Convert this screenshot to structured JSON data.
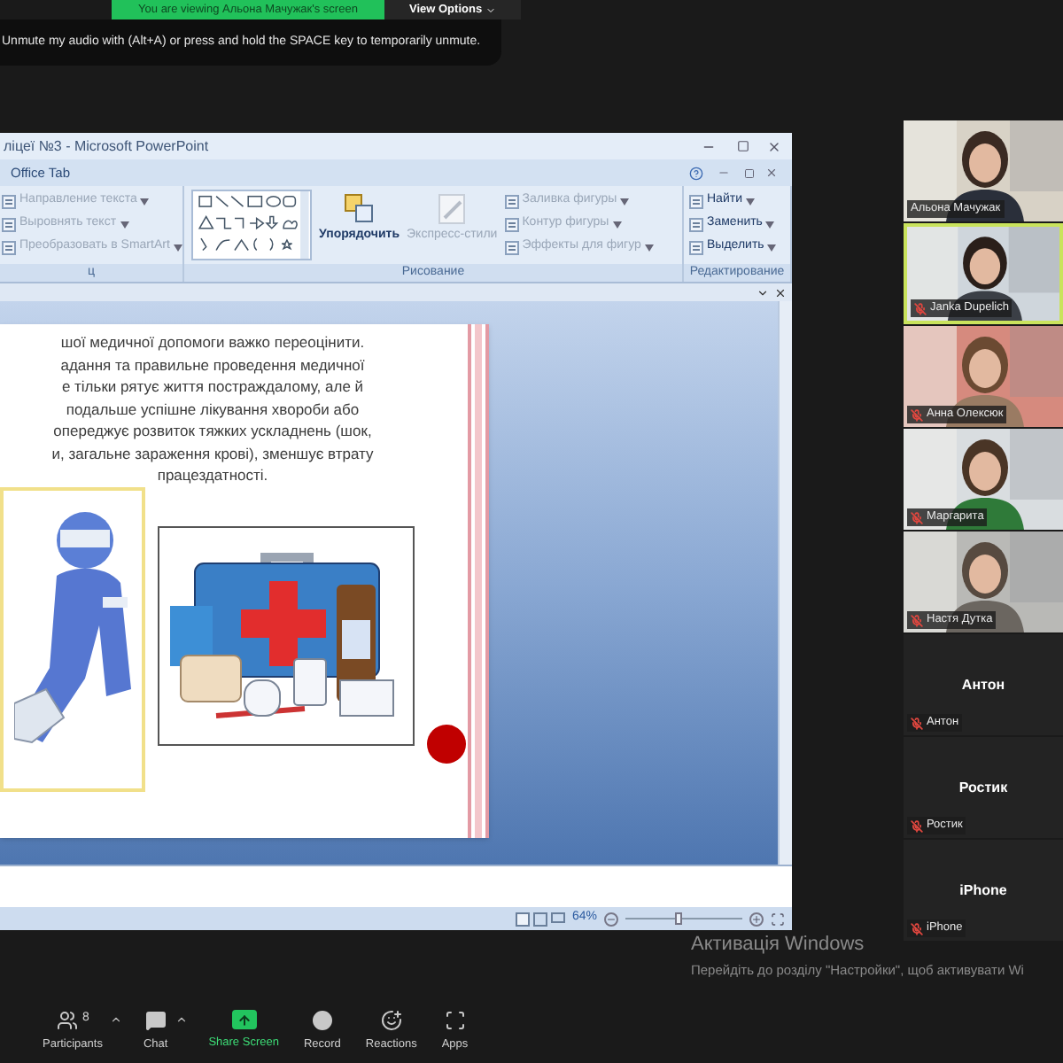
{
  "banner": {
    "text": "You are viewing Альона Мачужак's screen",
    "view_options": "View Options"
  },
  "notification": "Unmute my audio with (Alt+A) or press and hold the SPACE key to temporarily unmute.",
  "powerpoint": {
    "title": "ліцеї №3 - Microsoft PowerPoint",
    "office_tab": "Office Tab",
    "ribbon_groups": [
      {
        "kind": "text",
        "label": "ц",
        "items": [
          {
            "label": "Направление текста",
            "disabled": true
          },
          {
            "label": "Выровнять текст",
            "disabled": true
          },
          {
            "label": "Преобразовать в SmartArt",
            "disabled": true
          }
        ]
      },
      {
        "kind": "drawing",
        "label": "Рисование",
        "arrange": {
          "label": "Упорядочить",
          "disabled": false
        },
        "quick_styles": {
          "label": "Экспресс-стили",
          "disabled": true
        },
        "items": [
          {
            "label": "Заливка фигуры",
            "disabled": true
          },
          {
            "label": "Контур фигуры",
            "disabled": true
          },
          {
            "label": "Эффекты для фигур",
            "disabled": true
          }
        ]
      },
      {
        "kind": "editing",
        "label": "Редактирование",
        "items": [
          {
            "label": "Найти",
            "disabled": false
          },
          {
            "label": "Заменить",
            "disabled": false
          },
          {
            "label": "Выделить",
            "disabled": false
          }
        ]
      }
    ],
    "slide": {
      "lines": [
        "шої медичної допомоги важко переоцінити.",
        "адання та правильне проведення медичної",
        "е тільки рятує життя постраждалому, але й",
        "подальше успішне лікування хвороби або",
        "опереджує розвиток тяжких ускладнень (шок,",
        "и, загальне зараження крові), зменшує втрату",
        "працездатності."
      ]
    },
    "zoom": "64%",
    "zoom_slider": {
      "level": 0.45
    }
  },
  "participants": [
    {
      "name": "Альона Мачужак",
      "kind": "video",
      "muted": false,
      "speaking": false
    },
    {
      "name": "Janka Dupelich",
      "kind": "video",
      "muted": true,
      "speaking": true
    },
    {
      "name": "Анна Олексюк",
      "kind": "video",
      "muted": true,
      "speaking": false
    },
    {
      "name": "Маргарита",
      "kind": "video",
      "muted": true,
      "speaking": false
    },
    {
      "name": "Настя Дутка",
      "kind": "video",
      "muted": true,
      "speaking": false
    },
    {
      "name": "Антон",
      "kind": "avatar",
      "avatar_label": "Антон",
      "muted": true,
      "speaking": false
    },
    {
      "name": "Ростик",
      "kind": "avatar",
      "avatar_label": "Ростик",
      "muted": true,
      "speaking": false
    },
    {
      "name": "iPhone",
      "kind": "avatar",
      "avatar_label": "iPhone",
      "muted": true,
      "speaking": false
    }
  ],
  "activation": {
    "title": "Активація Windows",
    "text": "Перейдіть до розділу \"Настройки\", щоб активувати Wi"
  },
  "toolbar": [
    {
      "kind": "participants",
      "label": "Participants",
      "count": "8",
      "menu": true
    },
    {
      "kind": "chat",
      "label": "Chat",
      "menu": true
    },
    {
      "kind": "share",
      "label": "Share Screen",
      "menu": false
    },
    {
      "kind": "record",
      "label": "Record",
      "menu": false
    },
    {
      "kind": "reactions",
      "label": "Reactions",
      "menu": false
    },
    {
      "kind": "apps",
      "label": "Apps",
      "menu": false
    }
  ]
}
